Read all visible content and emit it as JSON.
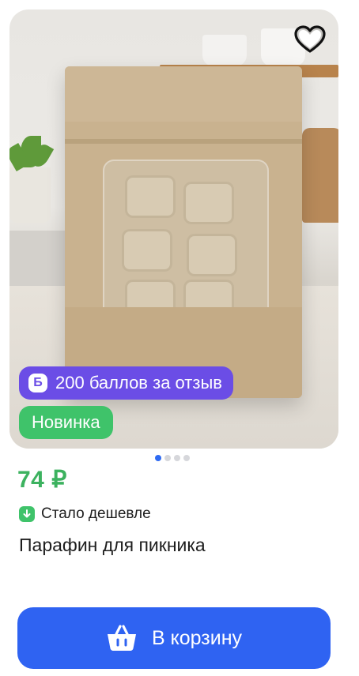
{
  "product": {
    "points_badge": "200 баллов за отзыв",
    "points_icon_letter": "Б",
    "new_badge": "Новинка",
    "price": "74 ₽",
    "price_note": "Стало дешевле",
    "title": "Парафин для пикника",
    "image_count": 4,
    "active_image": 1
  },
  "actions": {
    "cart_button": "В корзину"
  },
  "icons": {
    "favorite": "heart-icon",
    "points": "bonus-icon",
    "cheaper": "arrow-down-icon",
    "cart": "basket-icon"
  },
  "colors": {
    "accent_blue": "#2f63f2",
    "points_purple": "#6b4de6",
    "new_green": "#3fc36a",
    "price_green": "#3cb25f"
  }
}
